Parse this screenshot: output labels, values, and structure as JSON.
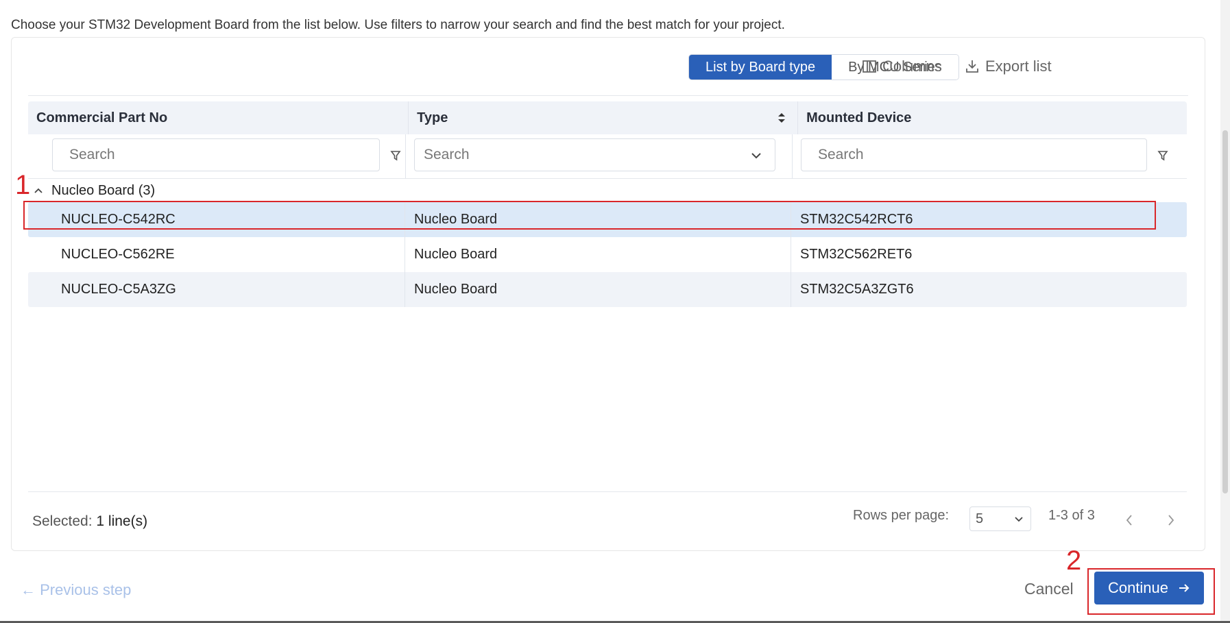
{
  "intro_text": "Choose your STM32 Development Board from the list below. Use filters to narrow your search and find the best match for your project.",
  "toolbar": {
    "view_options": [
      "List by Board type",
      "By MCU Series"
    ],
    "active_view": "List by Board type",
    "columns_label": "Columns",
    "export_label": "Export list"
  },
  "table": {
    "columns": [
      "Commercial Part No",
      "Type",
      "Mounted Device"
    ],
    "filters": {
      "part_placeholder": "Search",
      "type_placeholder": "Search",
      "device_placeholder": "Search"
    },
    "group": {
      "label": "Nucleo Board (3)"
    },
    "rows": [
      {
        "part": "NUCLEO-C542RC",
        "type": "Nucleo Board",
        "device": "STM32C542RCT6"
      },
      {
        "part": "NUCLEO-C562RE",
        "type": "Nucleo Board",
        "device": "STM32C562RET6"
      },
      {
        "part": "NUCLEO-C5A3ZG",
        "type": "Nucleo Board",
        "device": "STM32C5A3ZGT6"
      }
    ]
  },
  "footer": {
    "selected_label": "Selected:",
    "selected_value": "1 line(s)",
    "rows_per_page_label": "Rows per page:",
    "rows_per_page_value": "5",
    "page_range": "1-3 of 3"
  },
  "actions": {
    "previous_step": "← Previous step",
    "cancel": "Cancel",
    "continue": "Continue"
  },
  "annotations": [
    "1",
    "2"
  ],
  "colors": {
    "primary": "#2a60b8",
    "selected_row": "#dce9f8",
    "annotation": "#d9262a"
  }
}
